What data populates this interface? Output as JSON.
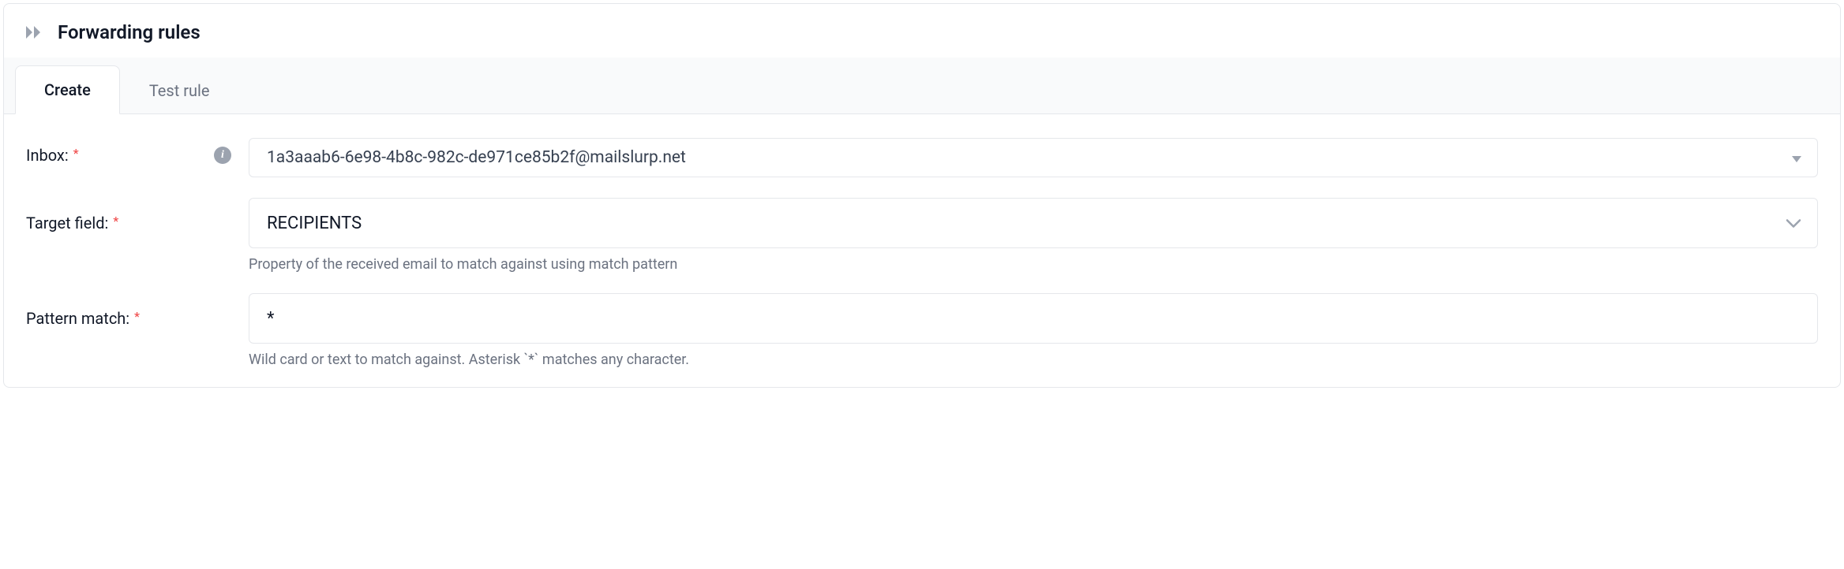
{
  "header": {
    "title": "Forwarding rules"
  },
  "tabs": {
    "create": "Create",
    "test": "Test rule"
  },
  "form": {
    "inbox": {
      "label": "Inbox:",
      "value": "1a3aaab6-6e98-4b8c-982c-de971ce85b2f@mailslurp.net"
    },
    "targetField": {
      "label": "Target field:",
      "value": "RECIPIENTS",
      "help": "Property of the received email to match against using match pattern"
    },
    "patternMatch": {
      "label": "Pattern match:",
      "value": "*",
      "help": "Wild card or text to match against. Asterisk `*` matches any character."
    }
  }
}
